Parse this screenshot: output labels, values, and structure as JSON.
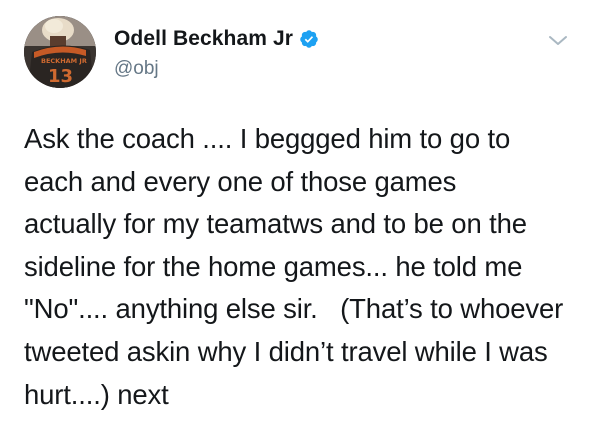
{
  "author": {
    "display_name": "Odell Beckham Jr",
    "handle": "@obj",
    "verified": true,
    "avatar_jersey_name": "BECKHAM JR",
    "avatar_jersey_number": "13"
  },
  "tweet": {
    "text": "Ask the coach .... I beggged him to go to\neach and every one of those games\nactually for my teamatws and to be on the\nsideline for the home games... he told me\n\"No\".... anything else sir.   (That’s to whoever\ntweeted askin why I didn’t travel while I was\nhurt....) next"
  },
  "icons": {
    "verified": "verified-badge-icon",
    "menu": "chevron-down-icon"
  },
  "colors": {
    "text": "#14171a",
    "secondary": "#657786",
    "verified_blue": "#1da1f2",
    "chevron": "#aab8c2"
  }
}
